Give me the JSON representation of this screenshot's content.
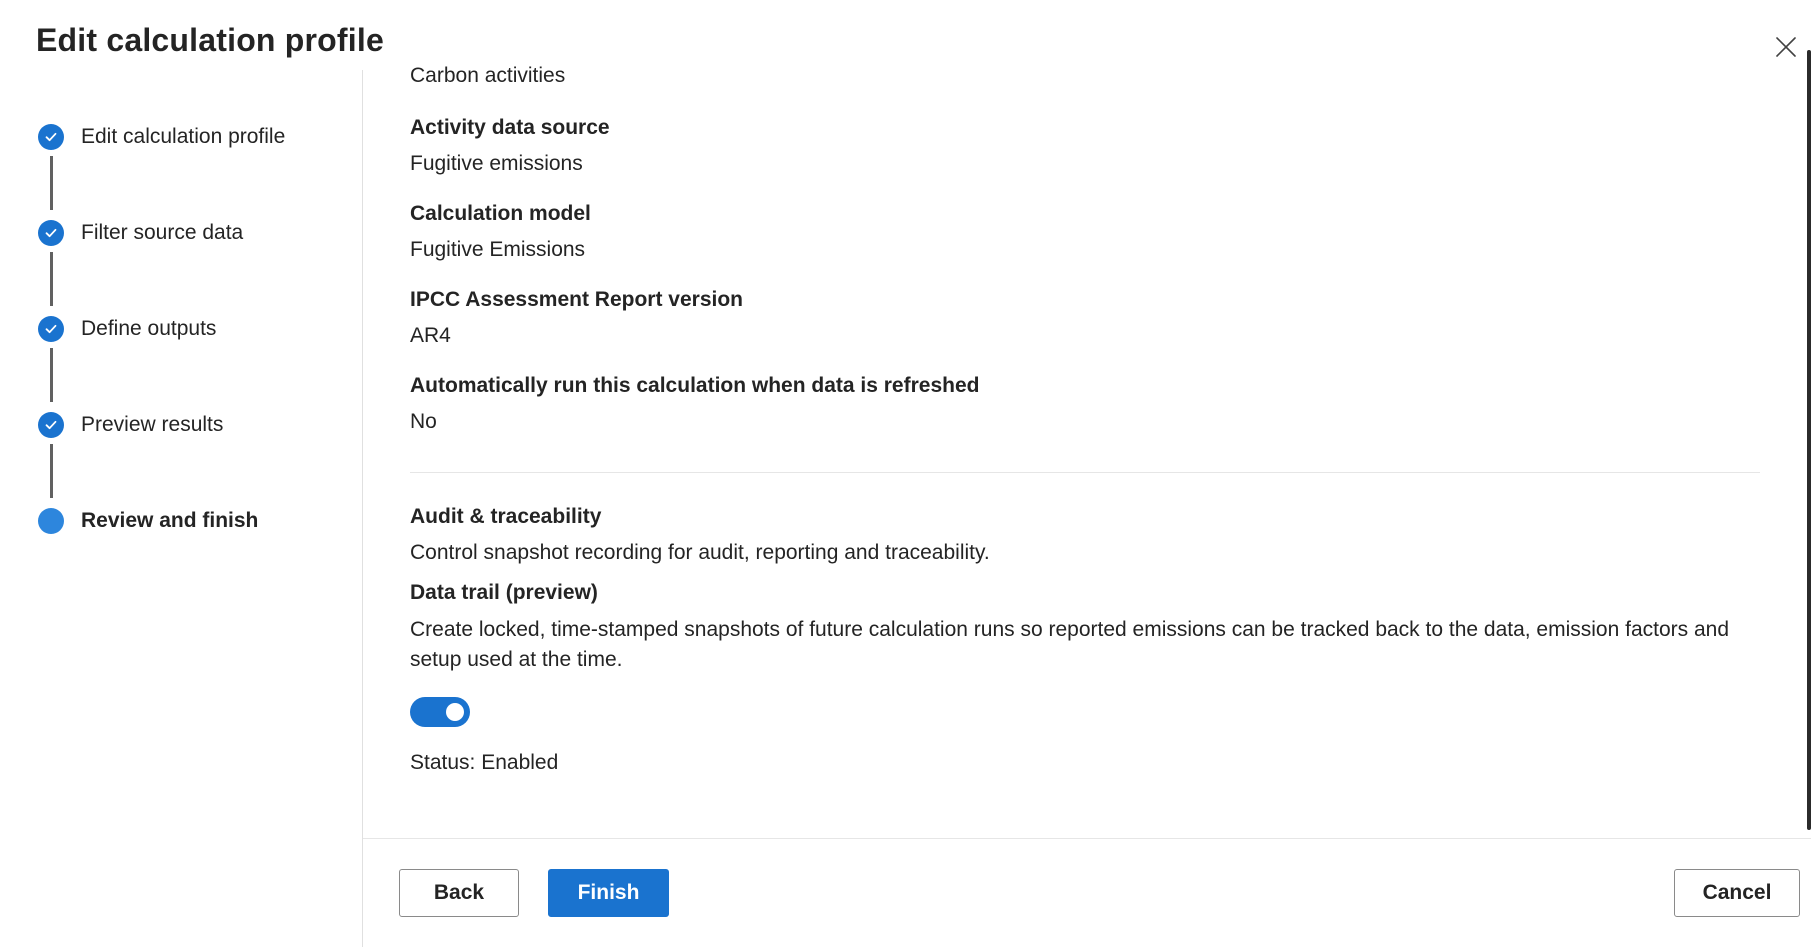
{
  "panel": {
    "title": "Edit calculation profile"
  },
  "stepper": {
    "steps": [
      {
        "label": "Edit calculation profile",
        "state": "completed"
      },
      {
        "label": "Filter source data",
        "state": "completed"
      },
      {
        "label": "Define outputs",
        "state": "completed"
      },
      {
        "label": "Preview results",
        "state": "completed"
      },
      {
        "label": "Review and finish",
        "state": "current"
      }
    ]
  },
  "details": {
    "module_value": "Carbon activities",
    "activity_source_label": "Activity data source",
    "activity_source_value": "Fugitive emissions",
    "calc_model_label": "Calculation model",
    "calc_model_value": "Fugitive Emissions",
    "ipcc_label": "IPCC Assessment Report version",
    "ipcc_value": "AR4",
    "auto_run_label": "Automatically run this calculation when data is refreshed",
    "auto_run_value": "No"
  },
  "audit": {
    "title": "Audit & traceability",
    "description": "Control snapshot recording for audit, reporting and traceability.",
    "data_trail_title": "Data trail (preview)",
    "data_trail_description": "Create locked, time-stamped snapshots of future calculation runs so reported emissions can be tracked back to the data, emission factors and setup used at the time.",
    "toggle_on": true,
    "status": "Status: Enabled"
  },
  "footer": {
    "back_label": "Back",
    "finish_label": "Finish",
    "cancel_label": "Cancel"
  },
  "colors": {
    "accent": "#1a73cf",
    "text": "#242424",
    "connector": "#616161"
  },
  "icons": {
    "close": "close-icon",
    "step_done": "checkmark-icon"
  }
}
